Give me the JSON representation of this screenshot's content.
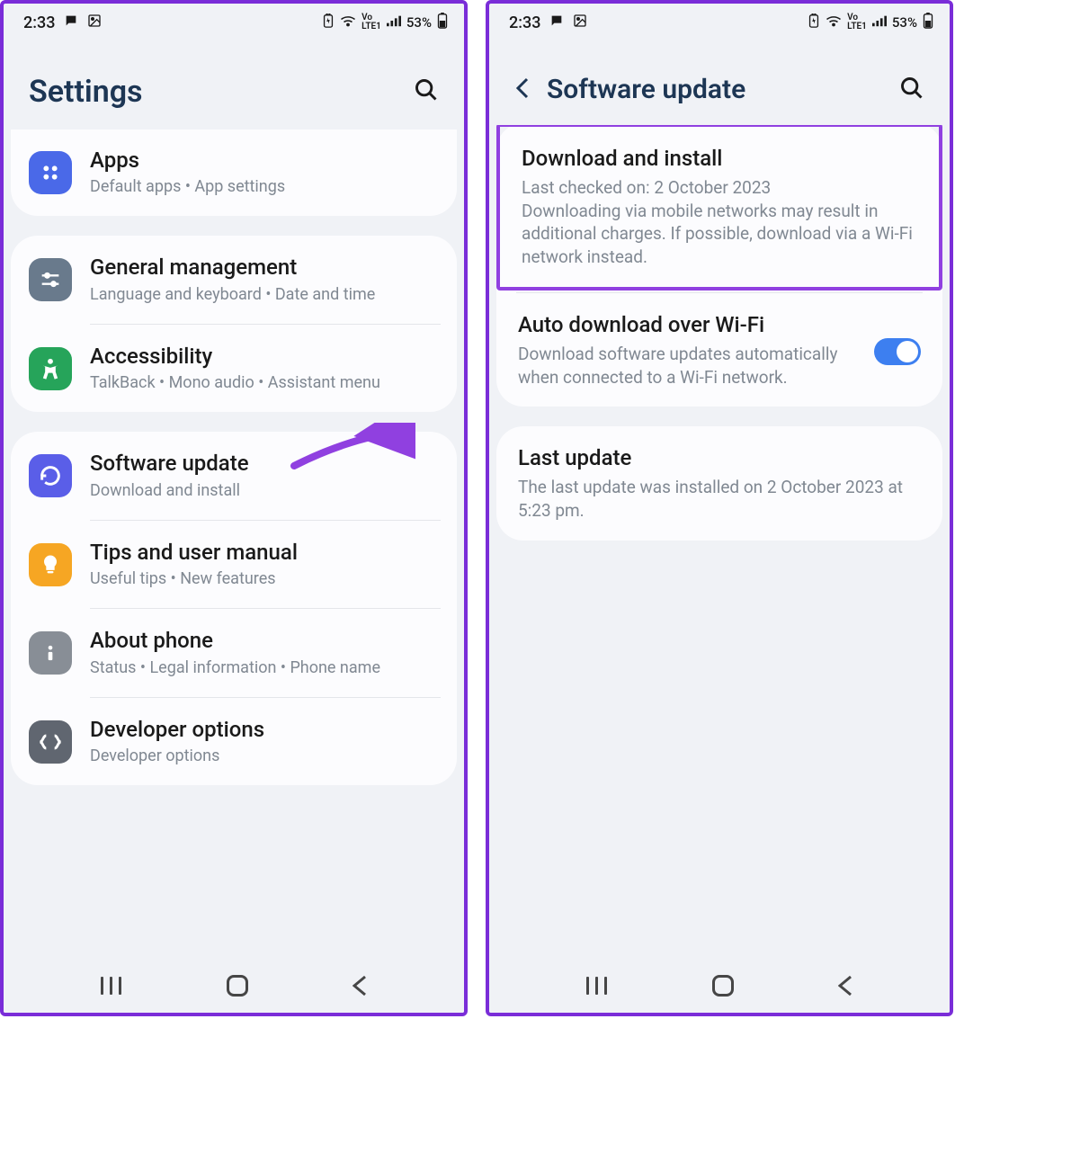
{
  "status": {
    "time": "2:33",
    "battery_pct": "53%",
    "lte_label": "Vo LTE1"
  },
  "screen1": {
    "title": "Settings",
    "groups": [
      {
        "items": [
          {
            "icon": "apps",
            "icon_color": "#4a69e8",
            "title": "Apps",
            "subtitle": "Default apps  •  App settings"
          }
        ]
      },
      {
        "items": [
          {
            "icon": "sliders",
            "icon_color": "#697a8c",
            "title": "General management",
            "subtitle": "Language and keyboard  •  Date and time"
          },
          {
            "icon": "accessibility",
            "icon_color": "#26a45a",
            "title": "Accessibility",
            "subtitle": "TalkBack  •  Mono audio  •  Assistant menu"
          }
        ]
      },
      {
        "items": [
          {
            "icon": "update",
            "icon_color": "#5a5ee8",
            "title": "Software update",
            "subtitle": "Download and install",
            "arrow": true
          },
          {
            "icon": "bulb",
            "icon_color": "#f6a623",
            "title": "Tips and user manual",
            "subtitle": "Useful tips  •  New features"
          },
          {
            "icon": "info",
            "icon_color": "#888e96",
            "title": "About phone",
            "subtitle": "Status  •  Legal information  •  Phone name"
          },
          {
            "icon": "code",
            "icon_color": "#606670",
            "title": "Developer options",
            "subtitle": "Developer options"
          }
        ]
      }
    ]
  },
  "screen2": {
    "title": "Software update",
    "download": {
      "title": "Download and install",
      "line1": "Last checked on: 2 October 2023",
      "line2": "Downloading via mobile networks may result in additional charges. If possible, download via a Wi-Fi network instead."
    },
    "auto": {
      "title": "Auto download over Wi-Fi",
      "subtitle": "Download software updates automatically when connected to a Wi-Fi network.",
      "enabled": true
    },
    "last": {
      "title": "Last update",
      "subtitle": "The last update was installed on 2 October 2023 at 5:23 pm."
    }
  }
}
